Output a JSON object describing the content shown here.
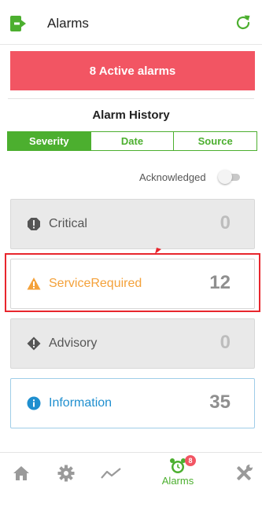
{
  "header": {
    "title": "Alarms",
    "exit_icon": "exit-icon",
    "refresh_icon": "refresh-icon"
  },
  "banner": {
    "text": "8 Active alarms",
    "color": "#f25563"
  },
  "history": {
    "title": "Alarm History",
    "tabs": [
      {
        "label": "Severity",
        "active": true
      },
      {
        "label": "Date",
        "active": false
      },
      {
        "label": "Source",
        "active": false
      }
    ],
    "acknowledged_label": "Acknowledged",
    "acknowledged_on": false
  },
  "cards": [
    {
      "label": "Critical",
      "count": "0",
      "icon": "critical-icon"
    },
    {
      "label": "ServiceRequired",
      "count": "12",
      "icon": "warning-triangle-icon"
    },
    {
      "label": "Advisory",
      "count": "0",
      "icon": "advisory-icon"
    },
    {
      "label": "Information",
      "count": "35",
      "icon": "info-icon"
    }
  ],
  "nav": {
    "items": [
      {
        "name": "home",
        "icon": "home-icon"
      },
      {
        "name": "settings",
        "icon": "gear-icon"
      },
      {
        "name": "trends",
        "icon": "trend-icon"
      },
      {
        "name": "alarms",
        "icon": "alarm-clock-icon",
        "label": "Alarms",
        "badge": "8",
        "active": true
      },
      {
        "name": "service",
        "icon": "tools-icon"
      }
    ]
  },
  "colors": {
    "accent": "#4caf2f",
    "alert": "#f25563",
    "warning": "#f4a13a",
    "info": "#1f8fcf"
  }
}
